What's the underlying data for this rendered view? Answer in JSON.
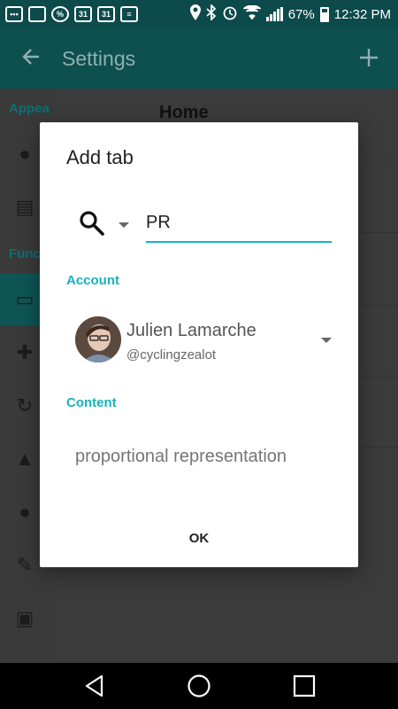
{
  "status_bar": {
    "battery": "67%",
    "time": "12:32 PM",
    "calendar_day_1": "31",
    "calendar_day_2": "31",
    "icons": [
      "ellipsis-icon",
      "cast-icon",
      "percent-icon",
      "calendar-icon",
      "calendar-icon",
      "message-icon",
      "location-icon",
      "bluetooth-icon",
      "alarm-icon",
      "wifi-icon",
      "signal-icon",
      "battery-icon"
    ]
  },
  "app_bar": {
    "title": "Settings",
    "back_icon": "arrow-back-icon",
    "add_icon": "plus-icon"
  },
  "background": {
    "sidebar_headers": [
      "Appea",
      "Func"
    ],
    "content_item": "Home"
  },
  "dialog": {
    "title": "Add tab",
    "query_value": "PR",
    "account_label": "Account",
    "account_name": "Julien Lamarche",
    "account_handle": "@cyclingzealot",
    "content_label": "Content",
    "content_value": "proportional representation",
    "ok_label": "OK"
  },
  "colors": {
    "accent": "#16b3bd",
    "appbar": "#0e4f50",
    "statusbar": "#0d4a4b"
  }
}
